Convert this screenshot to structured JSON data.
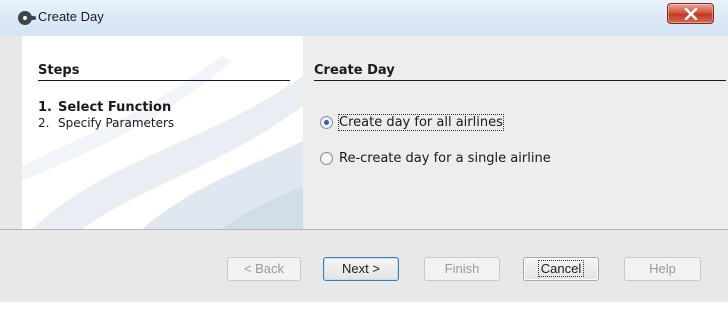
{
  "window": {
    "title": "Create Day",
    "icon": "app-logo-icon",
    "close_icon": "close-icon"
  },
  "steps": {
    "title": "Steps",
    "items": [
      {
        "number": "1.",
        "label": "Select Function",
        "active": true
      },
      {
        "number": "2.",
        "label": "Specify Parameters",
        "active": false
      }
    ]
  },
  "main": {
    "title": "Create Day",
    "options": [
      {
        "label": "Create day for all airlines",
        "checked": true
      },
      {
        "label": "Re-create day for a single airline",
        "checked": false
      }
    ]
  },
  "buttons": {
    "back": "< Back",
    "next": "Next >",
    "finish": "Finish",
    "cancel": "Cancel",
    "help": "Help"
  },
  "colors": {
    "titlebar": "#dbe8f6",
    "close_button": "#c23a22",
    "dialog_bg": "#e8e8e8",
    "radio_dot": "#2a60b8"
  }
}
